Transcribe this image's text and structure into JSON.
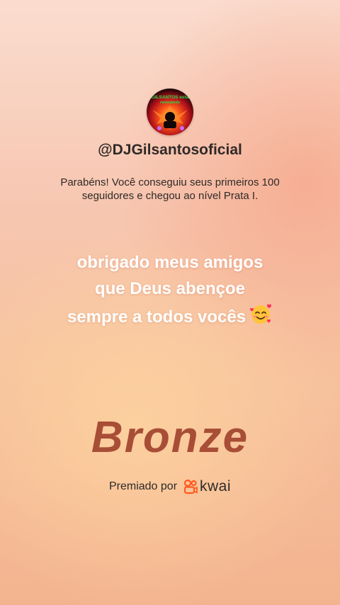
{
  "profile": {
    "avatar_text_line1": "GILSANTOS está",
    "avatar_text_line2": "renovando",
    "username": "@DJGilsantosoficial"
  },
  "congrats_text": "Parabéns! Você conseguiu seus primeiros 100 seguidores e chegou ao nível Prata I.",
  "message": {
    "text": "obrigado meus amigos que Deus abençoe sempre a todos vocês",
    "emoji": "🥰"
  },
  "level_name": "Bronze",
  "award": {
    "label": "Premiado por",
    "brand_icon": "kwai-logo-icon",
    "brand_name": "kwai"
  },
  "colors": {
    "level_text": "#a84e36",
    "brand_orange": "#ff5a1f"
  }
}
